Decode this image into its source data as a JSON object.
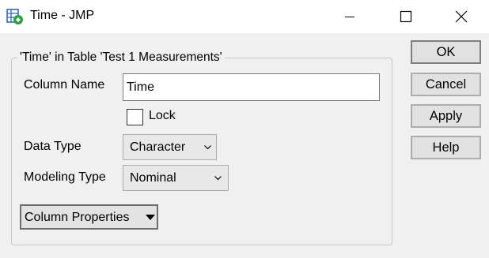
{
  "window": {
    "title": "Time - JMP",
    "icon": "jmp-app-icon"
  },
  "group": {
    "legend": "'Time' in Table 'Test 1 Measurements'"
  },
  "fields": {
    "column_name_label": "Column Name",
    "column_name_value": "Time",
    "lock_label": "Lock",
    "lock_checked": false,
    "data_type_label": "Data Type",
    "data_type_value": "Character",
    "modeling_type_label": "Modeling Type",
    "modeling_type_value": "Nominal",
    "column_properties_label": "Column Properties"
  },
  "buttons": {
    "ok": "OK",
    "cancel": "Cancel",
    "apply": "Apply",
    "help": "Help"
  },
  "colors": {
    "background": "#f0f0f0",
    "titlebar": "#ffffff",
    "icon_green": "#2e9e3e",
    "icon_blue": "#2f5fa8"
  }
}
